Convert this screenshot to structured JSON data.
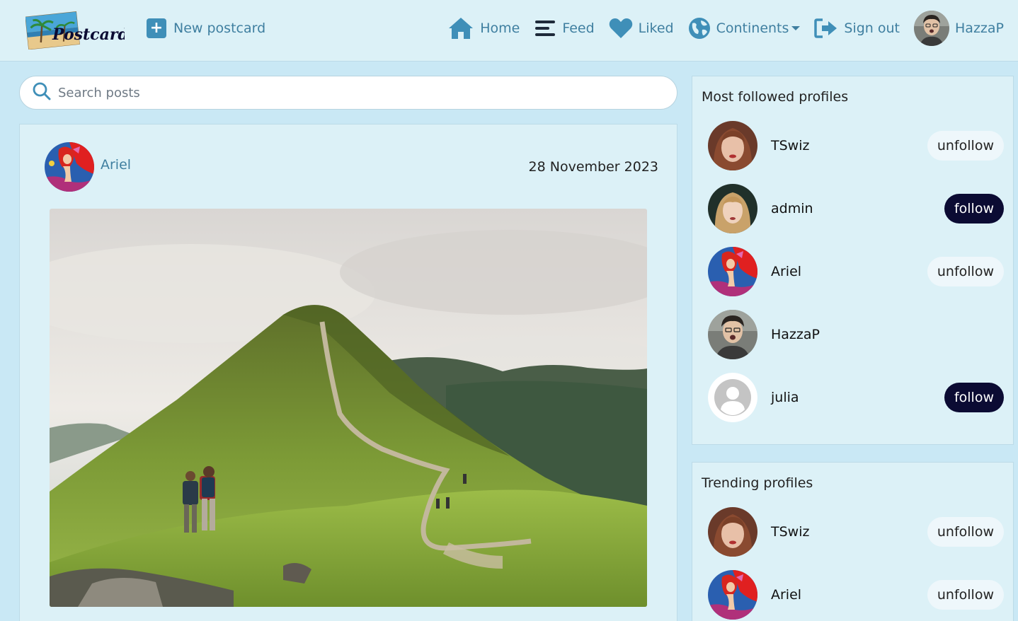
{
  "navbar": {
    "logo_text": "Postcards",
    "new_postcard": "New postcard",
    "links": {
      "home": "Home",
      "feed": "Feed",
      "liked": "Liked",
      "continents": "Continents",
      "sign_out": "Sign out",
      "user": "HazzaP"
    }
  },
  "search": {
    "placeholder": "Search posts"
  },
  "post": {
    "author": "Ariel",
    "date": "28 November 2023"
  },
  "most_followed": {
    "title": "Most followed profiles",
    "profiles": [
      {
        "name": "TSwiz",
        "action": "unfollow"
      },
      {
        "name": "admin",
        "action": "follow"
      },
      {
        "name": "Ariel",
        "action": "unfollow"
      },
      {
        "name": "HazzaP",
        "action": ""
      },
      {
        "name": "julia",
        "action": "follow"
      }
    ]
  },
  "trending": {
    "title": "Trending profiles",
    "profiles": [
      {
        "name": "TSwiz",
        "action": "unfollow"
      },
      {
        "name": "Ariel",
        "action": "unfollow"
      }
    ]
  },
  "colors": {
    "page_bg": "#c9e8f5",
    "card_bg": "#dcf1f7",
    "accent": "#3f7fa0",
    "follow_btn": "#0b0b33"
  }
}
